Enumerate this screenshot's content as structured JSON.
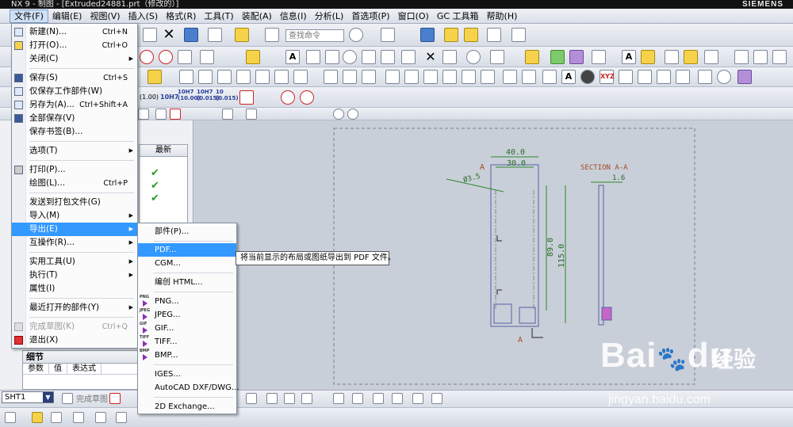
{
  "window": {
    "title": "NX 9 - 制图 - [Extruded24881.prt（修改的）]",
    "brand": "SIEMENS"
  },
  "menubar": [
    "文件(F)",
    "编辑(E)",
    "视图(V)",
    "插入(S)",
    "格式(R)",
    "工具(T)",
    "装配(A)",
    "信息(I)",
    "分析(L)",
    "首选项(P)",
    "窗口(O)",
    "GC 工具箱",
    "帮助(H)"
  ],
  "toolbar": {
    "search_placeholder": "查找命令"
  },
  "file_menu": {
    "items": [
      {
        "label": "新建(N)...",
        "shortcut": "Ctrl+N"
      },
      {
        "label": "打开(O)...",
        "shortcut": "Ctrl+O"
      },
      {
        "label": "关闭(C)",
        "submenu": true
      },
      {
        "label": "保存(S)",
        "shortcut": "Ctrl+S"
      },
      {
        "label": "仅保存工作部件(W)"
      },
      {
        "label": "另存为(A)...",
        "shortcut": "Ctrl+Shift+A"
      },
      {
        "label": "全部保存(V)"
      },
      {
        "label": "保存书签(B)..."
      },
      {
        "label": "选项(T)",
        "submenu": true
      },
      {
        "label": "打印(P)..."
      },
      {
        "label": "绘图(L)...",
        "shortcut": "Ctrl+P"
      },
      {
        "label": "发送到打包文件(G)"
      },
      {
        "label": "导入(M)",
        "submenu": true
      },
      {
        "label": "导出(E)",
        "submenu": true
      },
      {
        "label": "互操作(R)...",
        "submenu": true
      },
      {
        "label": "实用工具(U)",
        "submenu": true
      },
      {
        "label": "执行(T)",
        "submenu": true
      },
      {
        "label": "属性(I)"
      },
      {
        "label": "最近打开的部件(Y)",
        "submenu": true
      },
      {
        "label": "完成草图(K)",
        "shortcut": "Ctrl+Q"
      },
      {
        "label": "退出(X)"
      }
    ]
  },
  "export_menu": {
    "items": [
      {
        "label": "部件(P)..."
      },
      {
        "label": "PDF..."
      },
      {
        "label": "CGM..."
      },
      {
        "label": "编创 HTML..."
      },
      {
        "label": "PNG...",
        "tag": "PNG"
      },
      {
        "label": "JPEG...",
        "tag": "JPEG"
      },
      {
        "label": "GIF...",
        "tag": "GIF"
      },
      {
        "label": "TIFF...",
        "tag": "TIFF"
      },
      {
        "label": "BMP...",
        "tag": "BMP"
      },
      {
        "label": "IGES..."
      },
      {
        "label": "AutoCAD DXF/DWG..."
      },
      {
        "label": "2D Exchange..."
      }
    ]
  },
  "tooltip": "将当前显示的布局或图纸导出到 PDF 文件。",
  "toolbar_fits": [
    "(1.00)",
    "10H7",
    "10H7 (10.00)",
    "10H7 (0.015)",
    "10 (0.015)"
  ],
  "nav": {
    "latest_header": "最新"
  },
  "details": {
    "title": "细节",
    "columns": [
      "参数",
      "值",
      "表达式"
    ]
  },
  "bottom": {
    "sheet": "SHT1",
    "finish_sketch": "完成草图"
  },
  "drawing": {
    "dim_40": "40.0",
    "dim_30": "30.0",
    "dim_dia": "Ø3.5",
    "dim_89": "89.0",
    "dim_115": "115.0",
    "dim_16": "1.6",
    "section_label": "SECTION A-A",
    "section_letter_top": "A",
    "section_letter_bottom": "A"
  },
  "watermark": {
    "logo": "Bai",
    "logo2": "du",
    "cn": "经验",
    "url": "jingyan.baidu.com"
  }
}
